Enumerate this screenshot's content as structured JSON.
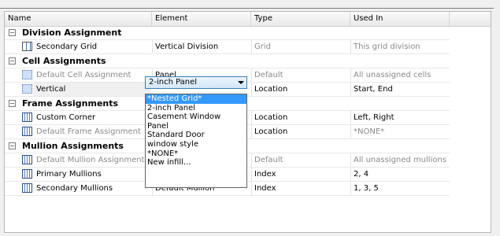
{
  "columns": [
    "Name",
    "Element",
    "Type",
    "Used In"
  ],
  "groups": {
    "division": "Division Assignment",
    "cell": "Cell Assignments",
    "frame": "Frame Assignments",
    "mullion": "Mullion Assignments"
  },
  "rows": {
    "secondary_grid": {
      "name": "Secondary Grid",
      "element": "Vertical Division",
      "type": "Grid",
      "used_in": "This grid division"
    },
    "default_cell": {
      "name": "Default Cell Assignment",
      "element": "Panel",
      "type": "Default",
      "used_in": "All unassigned cells"
    },
    "vertical": {
      "name": "Vertical",
      "type": "Location",
      "used_in": "Start, End"
    },
    "custom_corner": {
      "name": "Custom Corner",
      "type": "Location",
      "used_in": "Left, Right"
    },
    "default_frame": {
      "name": "Default Frame Assignment",
      "type": "Location",
      "used_in": "*NONE*"
    },
    "default_mullion": {
      "name": "Default Mullion Assignment",
      "type": "Default",
      "used_in": "All unassigned mullions"
    },
    "primary_mullions": {
      "name": "Primary Mullions",
      "type": "Index",
      "used_in": "2, 4"
    },
    "secondary_mullions": {
      "name": "Secondary Mullions",
      "element": "Default Mullion",
      "type": "Index",
      "used_in": "1, 3, 5"
    }
  },
  "combo": {
    "value": "2-inch Panel"
  },
  "dropdown": {
    "items": [
      "*Nested Grid*",
      "2-inch Panel",
      "Casement Window",
      "Panel",
      "Standard Door",
      "window style",
      "*NONE*",
      "New infill..."
    ],
    "selected_index": 0
  },
  "colors": {
    "selection": "#3399ff",
    "combo_border": "#3c7fb1"
  }
}
